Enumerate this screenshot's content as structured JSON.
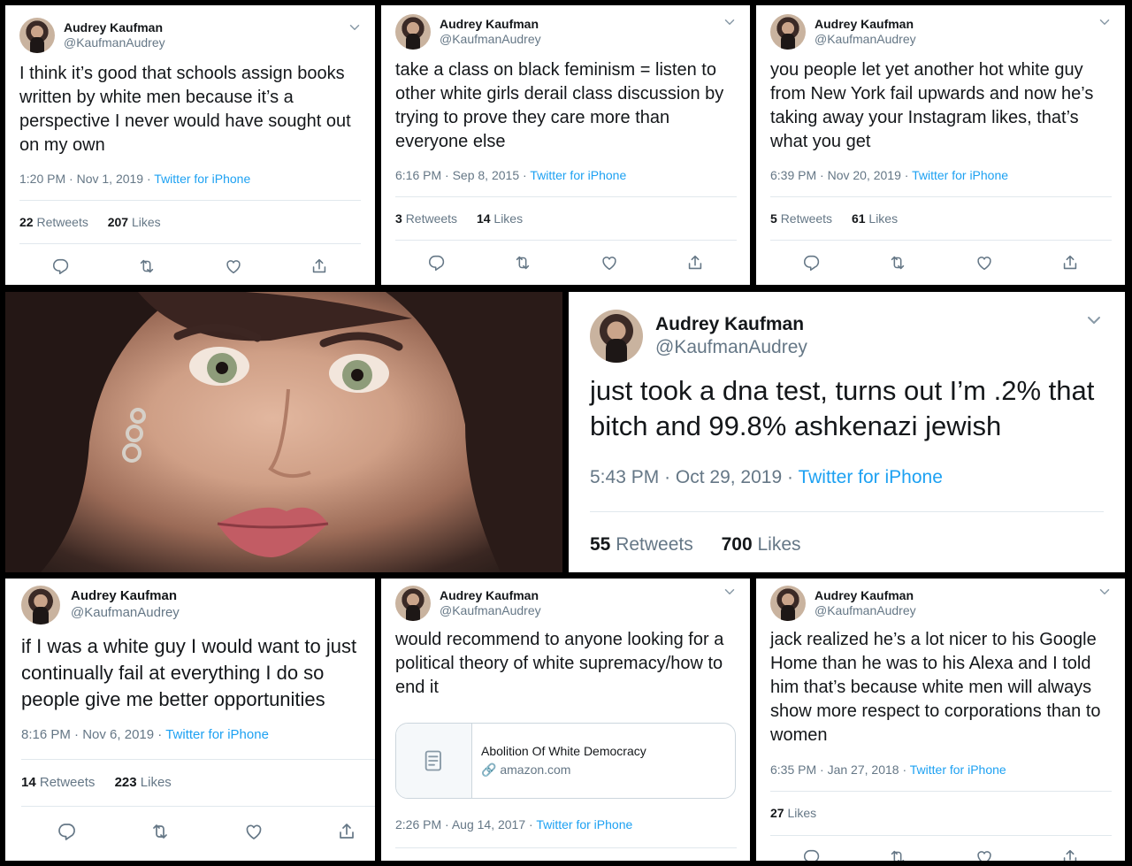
{
  "author": {
    "name": "Audrey Kaufman",
    "handle": "@KaufmanAudrey"
  },
  "labels": {
    "retweets": "Retweets",
    "likes": "Likes",
    "separator": "·"
  },
  "icons": [
    "reply-icon",
    "retweet-icon",
    "like-icon",
    "share-icon",
    "chevron-down-icon",
    "document-icon",
    "link-icon"
  ],
  "colors": {
    "accent": "#1da1f2",
    "muted": "#657786",
    "text": "#14171a"
  },
  "tweets": [
    {
      "text": "I think it’s good that schools assign books written by white men because it’s a perspective I never would have sought out on my own",
      "time": "1:20 PM",
      "date": "Nov 1, 2019",
      "source": "Twitter for iPhone",
      "retweets": "22",
      "likes": "207"
    },
    {
      "text": "take a class on black feminism = listen to other white girls derail class discussion by trying to prove they care more than everyone else",
      "time": "6:16 PM",
      "date": "Sep 8, 2015",
      "source": "Twitter for iPhone",
      "retweets": "3",
      "likes": "14"
    },
    {
      "text": "you people let yet another hot white guy from New York fail upwards and now he’s taking away your Instagram likes, that’s what you get",
      "time": "6:39 PM",
      "date": "Nov 20, 2019",
      "source": "Twitter for iPhone",
      "retweets": "5",
      "likes": "61"
    },
    {
      "text": "just took a dna test, turns out I’m .2% that bitch and 99.8% ashkenazi jewish",
      "time": "5:43 PM",
      "date": "Oct 29, 2019",
      "source": "Twitter for iPhone",
      "retweets": "55",
      "likes": "700"
    },
    {
      "text": "if I was a white guy I would want to just continually fail at everything I do so people give me better opportunities",
      "time": "8:16 PM",
      "date": "Nov 6, 2019",
      "source": "Twitter for iPhone",
      "retweets": "14",
      "likes": "223"
    },
    {
      "text": "would recommend to anyone looking for a political theory of white supremacy/how to end it",
      "time": "2:26 PM",
      "date": "Aug 14, 2017",
      "source": "Twitter for iPhone",
      "link": {
        "title": "Abolition Of White Democracy",
        "domain": "amazon.com"
      }
    },
    {
      "text": "jack realized he’s a lot nicer to his Google Home than he was to his Alexa and I told him that’s because white men will always show more respect to corporations than to women",
      "time": "6:35 PM",
      "date": "Jan 27, 2018",
      "source": "Twitter for iPhone",
      "likes": "27"
    }
  ]
}
